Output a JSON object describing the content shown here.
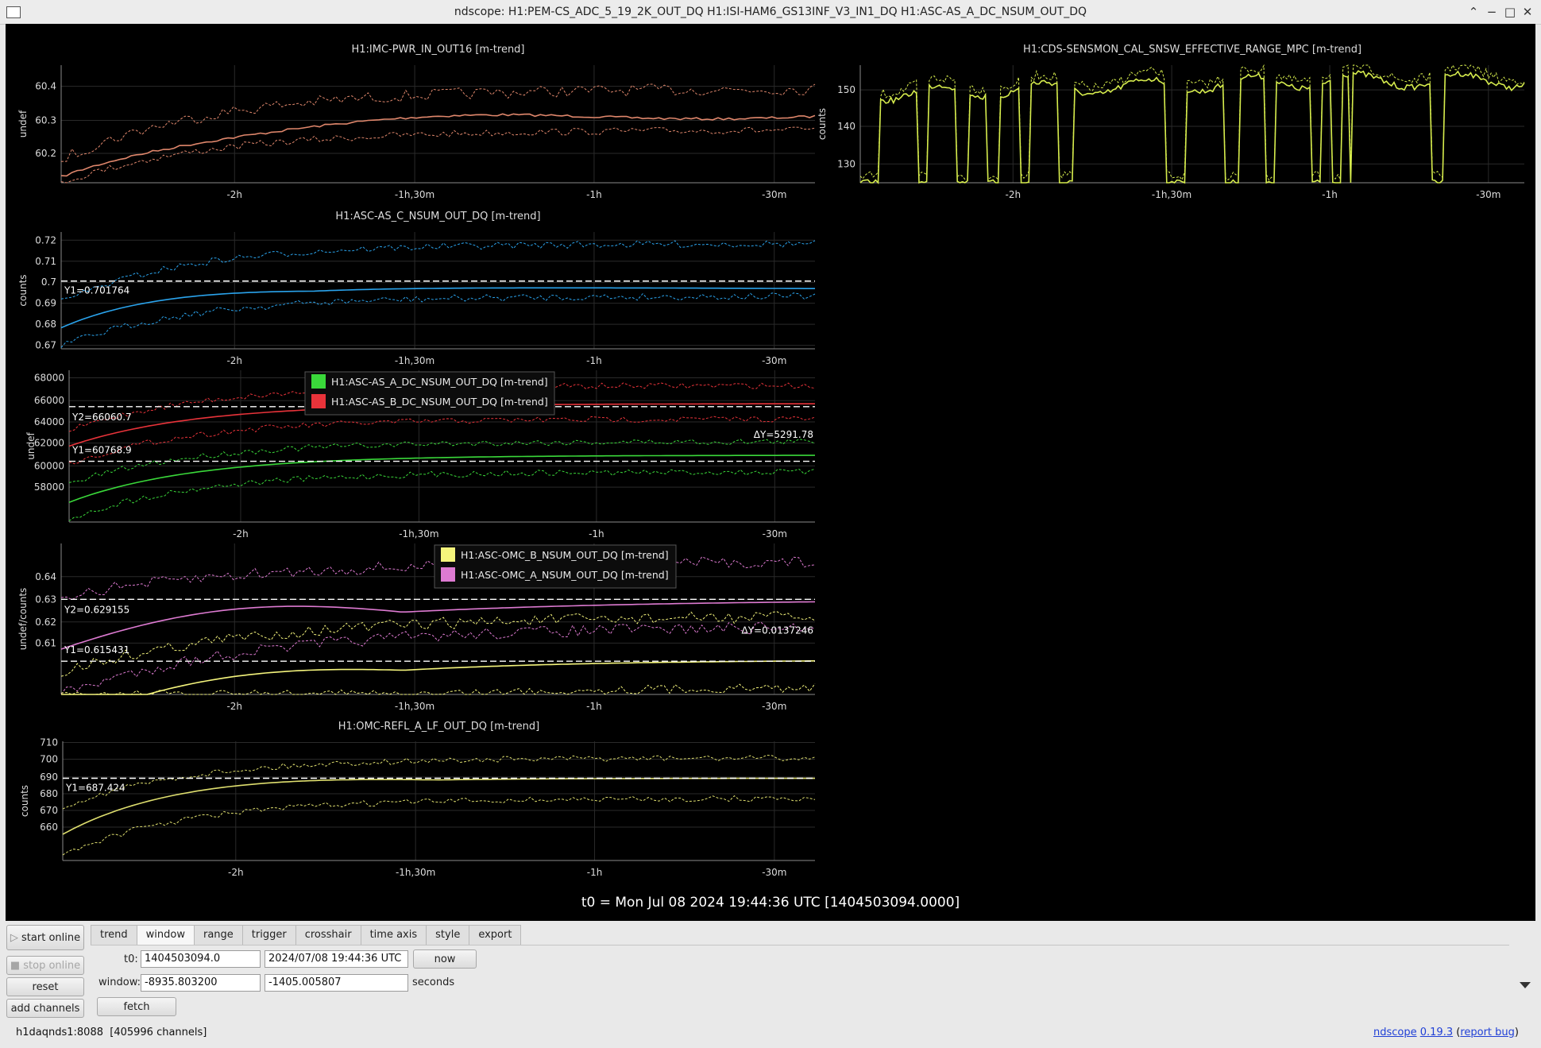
{
  "window": {
    "title": "ndscope: H1:PEM-CS_ADC_5_19_2K_OUT_DQ H1:ISI-HAM6_GS13INF_V3_IN1_DQ H1:ASC-AS_A_DC_NSUM_OUT_DQ",
    "controls": {
      "minimize": "−",
      "maximize": "□",
      "close": "✕",
      "shade": "⌃"
    }
  },
  "colors": {
    "background": "#000000",
    "grid": "#2a2a2a",
    "tick_text": "#dcdcdc",
    "cursor": "#ffffff",
    "ch_imc": "#e0876c",
    "ch_cds": "#d6ec4d",
    "ch_asc_c": "#2aa3ec",
    "ch_asc_a": "#3ad83a",
    "ch_asc_b": "#e8333a",
    "ch_omc_b": "#f4f47c",
    "ch_omc_a": "#dd7ad1",
    "ch_omc_refl": "#dede6e"
  },
  "x_ticks": [
    "-2h",
    "-1h,30m",
    "-1h",
    "-30m"
  ],
  "plots": [
    {
      "id": "imc",
      "title": "H1:IMC-PWR_IN_OUT16 [m-trend]",
      "ylabel": "undef",
      "yticks": [
        "60.4",
        "60.3",
        "60.2"
      ]
    },
    {
      "id": "cds",
      "title": "H1:CDS-SENSMON_CAL_SNSW_EFFECTIVE_RANGE_MPC [m-trend]",
      "ylabel": "counts",
      "yticks": [
        "150",
        "140",
        "130"
      ]
    },
    {
      "id": "asc_c",
      "title": "H1:ASC-AS_C_NSUM_OUT_DQ [m-trend]",
      "ylabel": "counts",
      "yticks": [
        "0.72",
        "0.71",
        "0.7",
        "0.69",
        "0.68",
        "0.67"
      ],
      "cursors": {
        "y1": "Y1=0.701764"
      }
    },
    {
      "id": "asc_ab",
      "title": "",
      "ylabel": "undef",
      "yticks": [
        "68000",
        "66000",
        "64000",
        "62000",
        "60000",
        "58000"
      ],
      "legend": [
        "H1:ASC-AS_A_DC_NSUM_OUT_DQ [m-trend]",
        "H1:ASC-AS_B_DC_NSUM_OUT_DQ [m-trend]"
      ],
      "cursors": {
        "y1": "Y1=60768.9",
        "y2": "Y2=66060.7",
        "dy": "ΔY=5291.78"
      }
    },
    {
      "id": "omc",
      "title": "",
      "ylabel": "undef/counts",
      "yticks": [
        "0.64",
        "0.63",
        "0.62",
        "0.61"
      ],
      "legend": [
        "H1:ASC-OMC_B_NSUM_OUT_DQ [m-trend]",
        "H1:ASC-OMC_A_NSUM_OUT_DQ [m-trend]"
      ],
      "cursors": {
        "y1": "Y1=0.615431",
        "y2": "Y2=0.629155",
        "dy": "ΔY=0.0137246"
      }
    },
    {
      "id": "omc_refl",
      "title": "H1:OMC-REFL_A_LF_OUT_DQ [m-trend]",
      "ylabel": "counts",
      "yticks": [
        "710",
        "700",
        "690",
        "680",
        "670",
        "660"
      ],
      "cursors": {
        "y1": "Y1=687.424"
      }
    }
  ],
  "t0_label": "t0 = Mon Jul 08 2024 19:44:36 UTC [1404503094.0000]",
  "sidebar_buttons": {
    "start_online": "start online",
    "stop_online": "stop online",
    "reset": "reset",
    "add_channels": "add channels"
  },
  "tabs": [
    "trend",
    "window",
    "range",
    "trigger",
    "crosshair",
    "time axis",
    "style",
    "export"
  ],
  "active_tab": "window",
  "window_tab": {
    "t0_label": "t0:",
    "t0_gps": "1404503094.0",
    "t0_utc": "2024/07/08 19:44:36 UTC",
    "now_button": "now",
    "window_label": "window:",
    "window_start": "-8935.803200",
    "window_end": "-1405.005807",
    "seconds_label": "seconds",
    "fetch_button": "fetch"
  },
  "status": {
    "server": "h1daqnds1:8088",
    "channels": "[405996 channels]"
  },
  "version": {
    "app": "ndscope",
    "version": "0.19.3",
    "report": "report bug",
    "open_paren": "(",
    "close_paren": ")"
  }
}
